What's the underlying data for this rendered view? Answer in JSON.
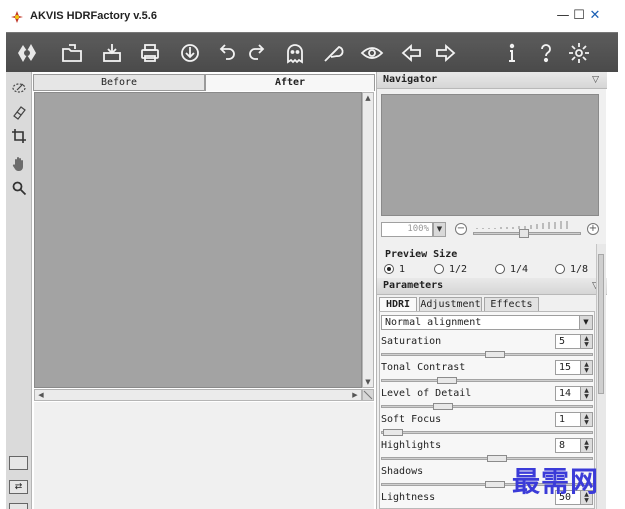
{
  "window": {
    "title": "AKVIS HDRFactory v.5.6",
    "minimize": "—",
    "maximize": "☐",
    "close": "✕",
    "accent": "#1a5fb4"
  },
  "toolbar": {
    "icons": [
      "logo-icon",
      "open-icon",
      "save-icon",
      "print-icon",
      "share-icon",
      "undo-icon",
      "redo-icon",
      "ghost-icon",
      "feather-icon",
      "eye-icon",
      "back-icon",
      "forward-icon",
      "info-icon",
      "help-icon",
      "settings-icon"
    ]
  },
  "left_tools": [
    "brush-icon",
    "eraser-icon",
    "crop-icon",
    "hand-icon",
    "zoom-icon"
  ],
  "image_tabs": {
    "before": "Before",
    "after": "After"
  },
  "navigator": {
    "title": "Navigator",
    "zoom_value": "100%",
    "zoom_minus": "−",
    "zoom_plus": "+"
  },
  "preview_size": {
    "title": "Preview Size",
    "options": [
      "1",
      "1/2",
      "1/4",
      "1/8"
    ],
    "selected": "1"
  },
  "parameters": {
    "title": "Parameters",
    "tabs": [
      "HDRI",
      "Adjustment",
      "Effects"
    ],
    "active_tab": "HDRI",
    "alignment": "Normal alignment",
    "rows": [
      {
        "label": "Saturation",
        "value": "5"
      },
      {
        "label": "Tonal Contrast",
        "value": "15"
      },
      {
        "label": "Level of Detail",
        "value": "14"
      },
      {
        "label": "Soft Focus",
        "value": "1"
      },
      {
        "label": "Highlights",
        "value": "8"
      },
      {
        "label": "Shadows",
        "value": ""
      },
      {
        "label": "Lightness",
        "value": "50"
      }
    ]
  },
  "watermark": "最需网",
  "colors": {
    "canvas_gray": "#a3a3a3",
    "toolbar_dark": "#4f4f4f",
    "watermark_blue": "#3b3bd8"
  }
}
